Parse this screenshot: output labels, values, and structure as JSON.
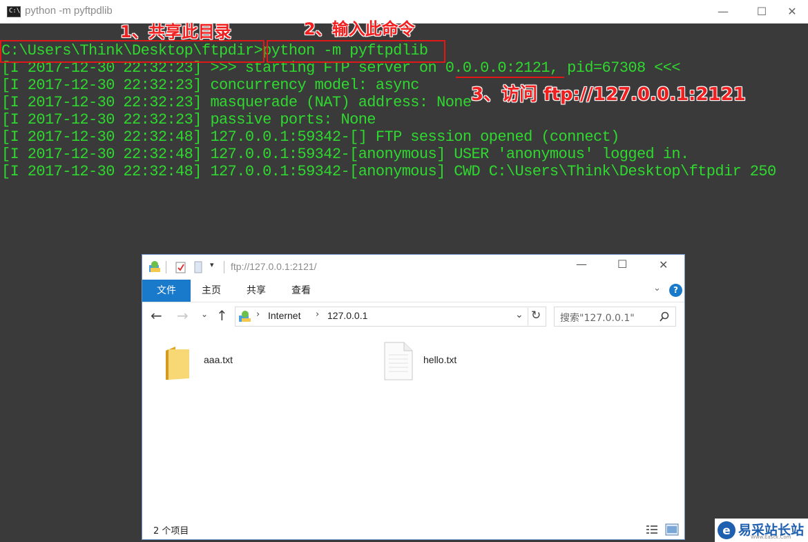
{
  "console_window": {
    "title": "python  -m pyftpdlib",
    "icon_text": "C:\\"
  },
  "console": {
    "prompt": "C:\\Users\\Think\\Desktop\\ftpdir>",
    "command": "python -m pyftpdlib",
    "lines": [
      "[I 2017-12-30 22:32:23] >>> starting FTP server on 0.0.0.0:2121, pid=67308 <<<",
      "[I 2017-12-30 22:32:23] concurrency model: async",
      "[I 2017-12-30 22:32:23] masquerade (NAT) address: None",
      "[I 2017-12-30 22:32:23] passive ports: None",
      "[I 2017-12-30 22:32:48] 127.0.0.1:59342-[] FTP session opened (connect)",
      "[I 2017-12-30 22:32:48] 127.0.0.1:59342-[anonymous] USER 'anonymous' logged in.",
      "[I 2017-12-30 22:32:48] 127.0.0.1:59342-[anonymous] CWD C:\\Users\\Think\\Desktop\\ftpdir 250"
    ]
  },
  "annotations": {
    "step1": "1、共享此目录",
    "step2": "2、输入此命令",
    "step3": "3、访问 ftp://127.0.0.1:2121"
  },
  "explorer": {
    "title": "ftp://127.0.0.1:2121/",
    "ribbon_tabs": [
      "文件",
      "主页",
      "共享",
      "查看"
    ],
    "help": "?",
    "breadcrumb": [
      "Internet",
      "127.0.0.1"
    ],
    "search_placeholder": "搜索\"127.0.0.1\"",
    "files": [
      {
        "name": "aaa.txt",
        "icon": "folder-icon"
      },
      {
        "name": "hello.txt",
        "icon": "text-file-icon"
      }
    ],
    "status": "2 个项目"
  },
  "watermark": {
    "text": "易采站长站",
    "sub": "Www.Easck.Com"
  },
  "colors": {
    "console_bg": "#3a3a3a",
    "console_text": "#2fd82f",
    "annotation_red": "#e01818",
    "explorer_accent": "#1979ca"
  }
}
